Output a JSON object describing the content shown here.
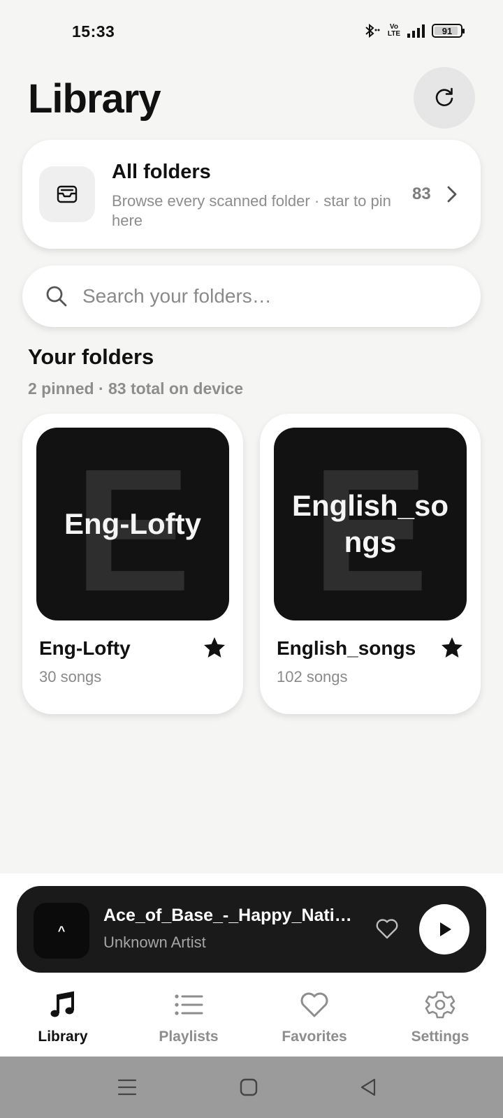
{
  "status_bar": {
    "time": "15:33",
    "network_label_top": "Vo",
    "network_label_bottom": "LTE",
    "battery": "91",
    "battery_level": 0.91,
    "icons": [
      "bluetooth-icon",
      "volte-icon",
      "signal-icon",
      "battery-icon"
    ]
  },
  "header": {
    "title": "Library",
    "refresh_icon": "refresh-icon"
  },
  "all_folders": {
    "title": "All folders",
    "subtitle": "Browse every scanned folder · star to pin here",
    "count": "83",
    "icon": "inbox-tray-icon"
  },
  "search": {
    "placeholder": "Search your folders…",
    "value": ""
  },
  "section": {
    "title": "Your folders",
    "subtitle": "2 pinned · 83 total on device"
  },
  "folders": [
    {
      "thumb_letter": "E",
      "thumb_name": "Eng-Lofty",
      "name": "Eng-Lofty",
      "songs": "30 songs",
      "starred": true
    },
    {
      "thumb_letter": "E",
      "thumb_name": "English_songs",
      "name": "English_songs",
      "songs": "102 songs",
      "starred": true
    }
  ],
  "mini_player": {
    "thumb_text": "^",
    "title": "Ace_of_Base_-_Happy_Nation",
    "artist": "Unknown Artist",
    "liked": false
  },
  "bottom_nav": {
    "items": [
      {
        "label": "Library",
        "icon": "music-note-icon",
        "active": true
      },
      {
        "label": "Playlists",
        "icon": "list-icon",
        "active": false
      },
      {
        "label": "Favorites",
        "icon": "heart-icon",
        "active": false
      },
      {
        "label": "Settings",
        "icon": "gear-icon",
        "active": false
      }
    ]
  },
  "colors": {
    "background": "#f5f5f4",
    "card": "#ffffff",
    "text": "#111111",
    "muted": "#8d8d8d",
    "player": "#1a1a1a"
  }
}
